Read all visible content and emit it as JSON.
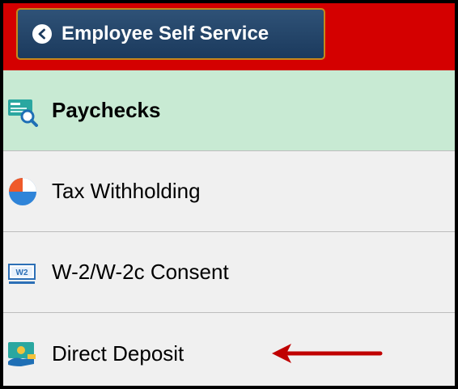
{
  "header": {
    "back_label": "Employee Self Service",
    "background_color": "#d40000",
    "button_color": "#1b3a5d"
  },
  "nav": {
    "items": [
      {
        "label": "Paychecks",
        "icon": "paycheck-icon",
        "active": true
      },
      {
        "label": "Tax Withholding",
        "icon": "pie-chart-icon",
        "active": false
      },
      {
        "label": "W-2/W-2c Consent",
        "icon": "w2-form-icon",
        "active": false
      },
      {
        "label": "Direct Deposit",
        "icon": "direct-deposit-icon",
        "active": false
      }
    ],
    "active_color": "#c8ead3"
  },
  "annotation": {
    "arrow_color": "#c00000"
  }
}
